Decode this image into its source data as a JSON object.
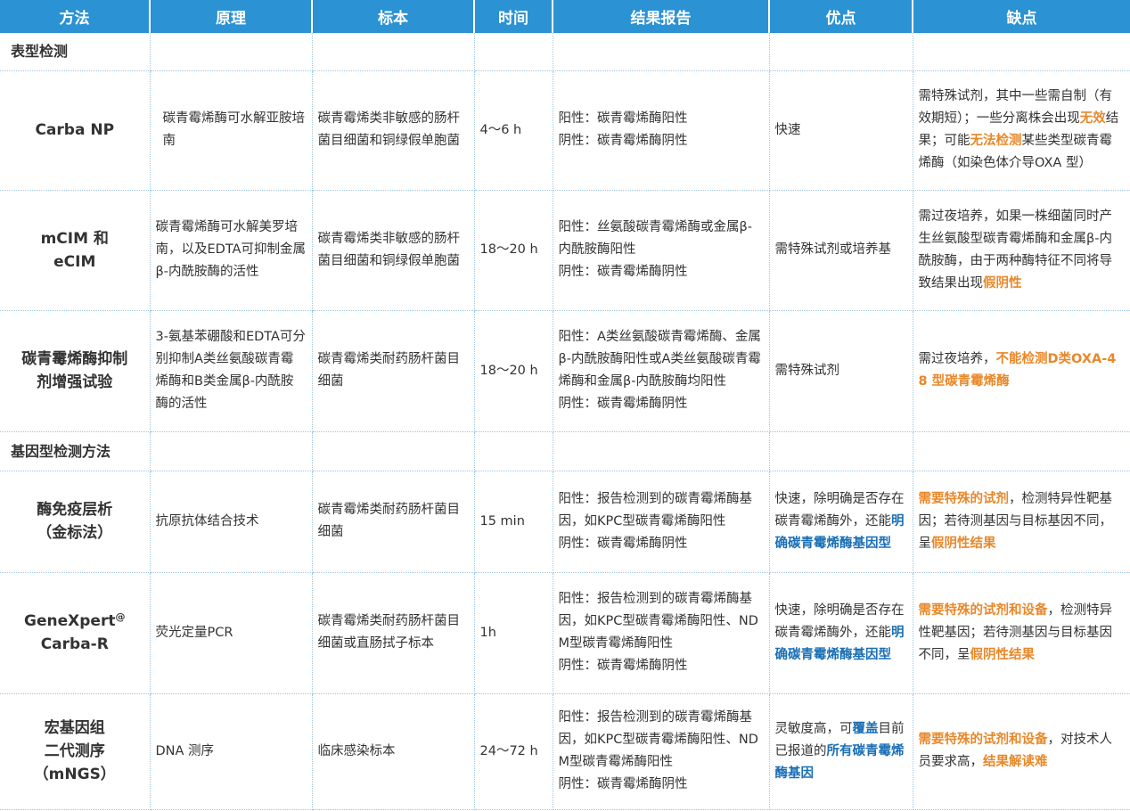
{
  "headers": [
    "方法",
    "原理",
    "标本",
    "时间",
    "结果报告",
    "优点",
    "缺点"
  ],
  "sections": {
    "phenotype": "表型检测",
    "genotype": "基因型检测方法"
  },
  "rows": {
    "carba_np": {
      "method": "Carba NP",
      "principle": "碳青霉烯酶可水解亚胺培南",
      "specimen": "碳青霉烯类非敏感的肠杆菌目细菌和铜绿假单胞菌",
      "time": "4～6 h",
      "result_pos": "阳性：碳青霉烯酶阳性",
      "result_neg": "阴性：碳青霉烯酶阴性",
      "advantage": "快速",
      "disadvantage": {
        "t1": "需特殊试剂，其中一些需自制（有效期短）；一些分离株会出现",
        "h1": "无效",
        "t2": "结果；可能",
        "h2": "无法检测",
        "t3": "某些类型碳青霉烯酶（如染色体介导OXA 型）"
      }
    },
    "mcim": {
      "method_l1": "mCIM 和",
      "method_l2": "eCIM",
      "principle": "碳青霉烯酶可水解美罗培南，以及EDTA可抑制金属β-内酰胺酶的活性",
      "specimen": "碳青霉烯类非敏感的肠杆菌目细菌和铜绿假单胞菌",
      "time": "18～20 h",
      "result_pos": "阳性：丝氨酸碳青霉烯酶或金属β-内酰胺酶阳性",
      "result_neg": "阴性：碳青霉烯酶阴性",
      "advantage": "需特殊试剂或培养基",
      "disadvantage": {
        "t1": "需过夜培养，如果一株细菌同时产生丝氨酸型碳青霉烯酶和金属β-内酰胺酶，由于两种酶特征不同将导致结果出现",
        "h1": "假阴性"
      }
    },
    "inhibitor": {
      "method_l1": "碳青霉烯酶抑制",
      "method_l2": "剂增强试验",
      "principle": "3-氨基苯硼酸和EDTA可分别抑制A类丝氨酸碳青霉烯酶和B类金属β-内酰胺酶的活性",
      "specimen": "碳青霉烯类耐药肠杆菌目细菌",
      "time": "18～20 h",
      "result_pos": "阳性：A类丝氨酸碳青霉烯酶、金属β-内酰胺酶阳性或A类丝氨酸碳青霉烯酶和金属β-内酰胺酶均阳性",
      "result_neg": "阴性：碳青霉烯酶阴性",
      "advantage": "需特殊试剂",
      "disadvantage": {
        "t1": "需过夜培养，",
        "h1": "不能检测D类OXA-48 型碳青霉烯酶"
      }
    },
    "immuno": {
      "method_l1": "酶免疫层析",
      "method_l2": "（金标法）",
      "principle": "抗原抗体结合技术",
      "specimen": "碳青霉烯类耐药肠杆菌目细菌",
      "time": "15 min",
      "result_pos": "阳性：报告检测到的碳青霉烯酶基因，如KPC型碳青霉烯酶阳性",
      "result_neg": "阴性：碳青霉烯酶阴性",
      "advantage": {
        "t1": "快速，除明确是否存在碳青霉烯酶外，还能",
        "h1": "明确碳青霉烯酶基因型"
      },
      "disadvantage": {
        "h1": "需要特殊的试剂",
        "t1": "，检测特异性靶基因；若待测基因与目标基因不同，呈",
        "h2": "假阴性结果"
      }
    },
    "genexpert": {
      "method_l1": "GeneXpert",
      "method_sup": "@",
      "method_l2": "Carba-R",
      "principle": "荧光定量PCR",
      "specimen": "碳青霉烯类耐药肠杆菌目细菌或直肠拭子标本",
      "time": "1h",
      "result_pos": "阳性：报告检测到的碳青霉烯酶基因，如KPC型碳青霉烯酶阳性、NDM型碳青霉烯酶阳性",
      "result_neg": "阴性：碳青霉烯酶阴性",
      "advantage": {
        "t1": "快速，除明确是否存在碳青霉烯酶外，还能",
        "h1": "明确碳青霉烯酶基因型"
      },
      "disadvantage": {
        "h1": "需要特殊的试剂和设备",
        "t1": "，检测特异性靶基因；若待测基因与目标基因不同，呈",
        "h2": "假阴性结果"
      }
    },
    "mngs": {
      "method_l1": "宏基因组",
      "method_l2": "二代测序",
      "method_l3": "（mNGS）",
      "principle": "DNA 测序",
      "specimen": "临床感染标本",
      "time": "24～72 h",
      "result_pos": "阳性：报告检测到的碳青霉烯酶基因，如KPC型碳青霉烯酶阳性、NDM型碳青霉烯酶阳性",
      "result_neg": "阴性：碳青霉烯酶阴性",
      "advantage": {
        "t1": "灵敏度高，可",
        "h1": "覆盖",
        "t2": "目前已报道的",
        "h2": "所有碳青霉烯酶基因"
      },
      "disadvantage": {
        "h1": "需要特殊的试剂和设备",
        "t1": "，对技术人员要求高，",
        "h2": "结果解读难"
      }
    }
  },
  "colors": {
    "header_bg": "#2b92d3",
    "highlight_orange": "#e8882a",
    "highlight_blue": "#1a6fb5",
    "divider": "#9bc6e3"
  }
}
